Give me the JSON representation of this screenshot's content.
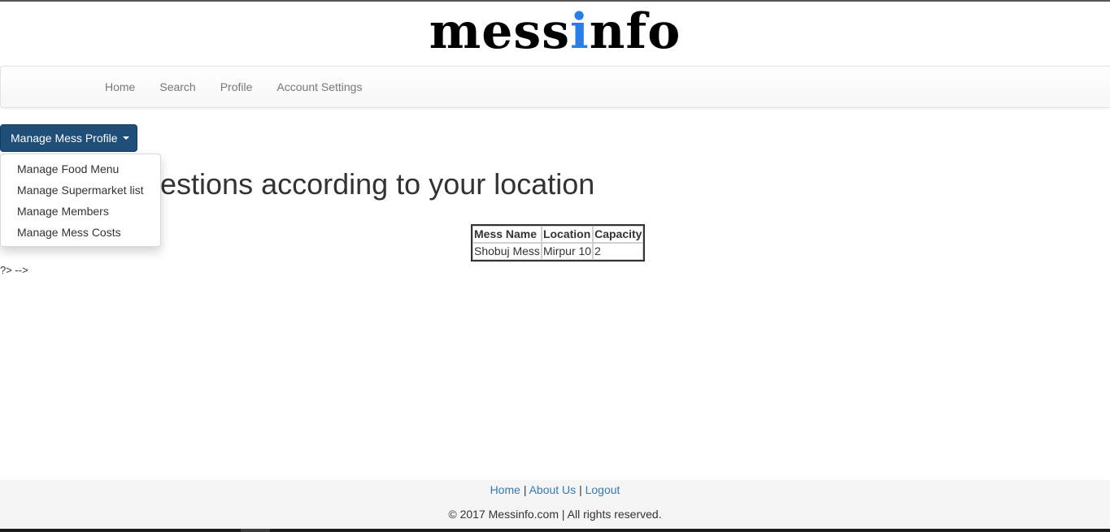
{
  "logo": {
    "prefix": "mess",
    "highlight": "i",
    "suffix": "nfo"
  },
  "nav": {
    "items": [
      "Home",
      "Search",
      "Profile",
      "Account Settings"
    ]
  },
  "manage_button": {
    "label": "Manage Mess Profile"
  },
  "dropdown": {
    "items": [
      "Manage Food Menu",
      "Manage Supermarket list",
      "Manage Members",
      "Manage Mess Costs"
    ]
  },
  "heading": "estions according to your location",
  "stray_text": "?> -->",
  "table": {
    "headers": [
      "Mess Name",
      "Location",
      "Capacity"
    ],
    "rows": [
      [
        "Shobuj Mess",
        "Mirpur 10",
        "2"
      ]
    ]
  },
  "footer": {
    "links": [
      "Home",
      "About Us",
      "Logout"
    ],
    "separator": "|",
    "copyright": "© 2017 Messinfo.com | All rights reserved."
  },
  "colors": {
    "accent_blue": "#2b7de9",
    "button_bg": "#1f4e79",
    "link": "#337ab7"
  }
}
